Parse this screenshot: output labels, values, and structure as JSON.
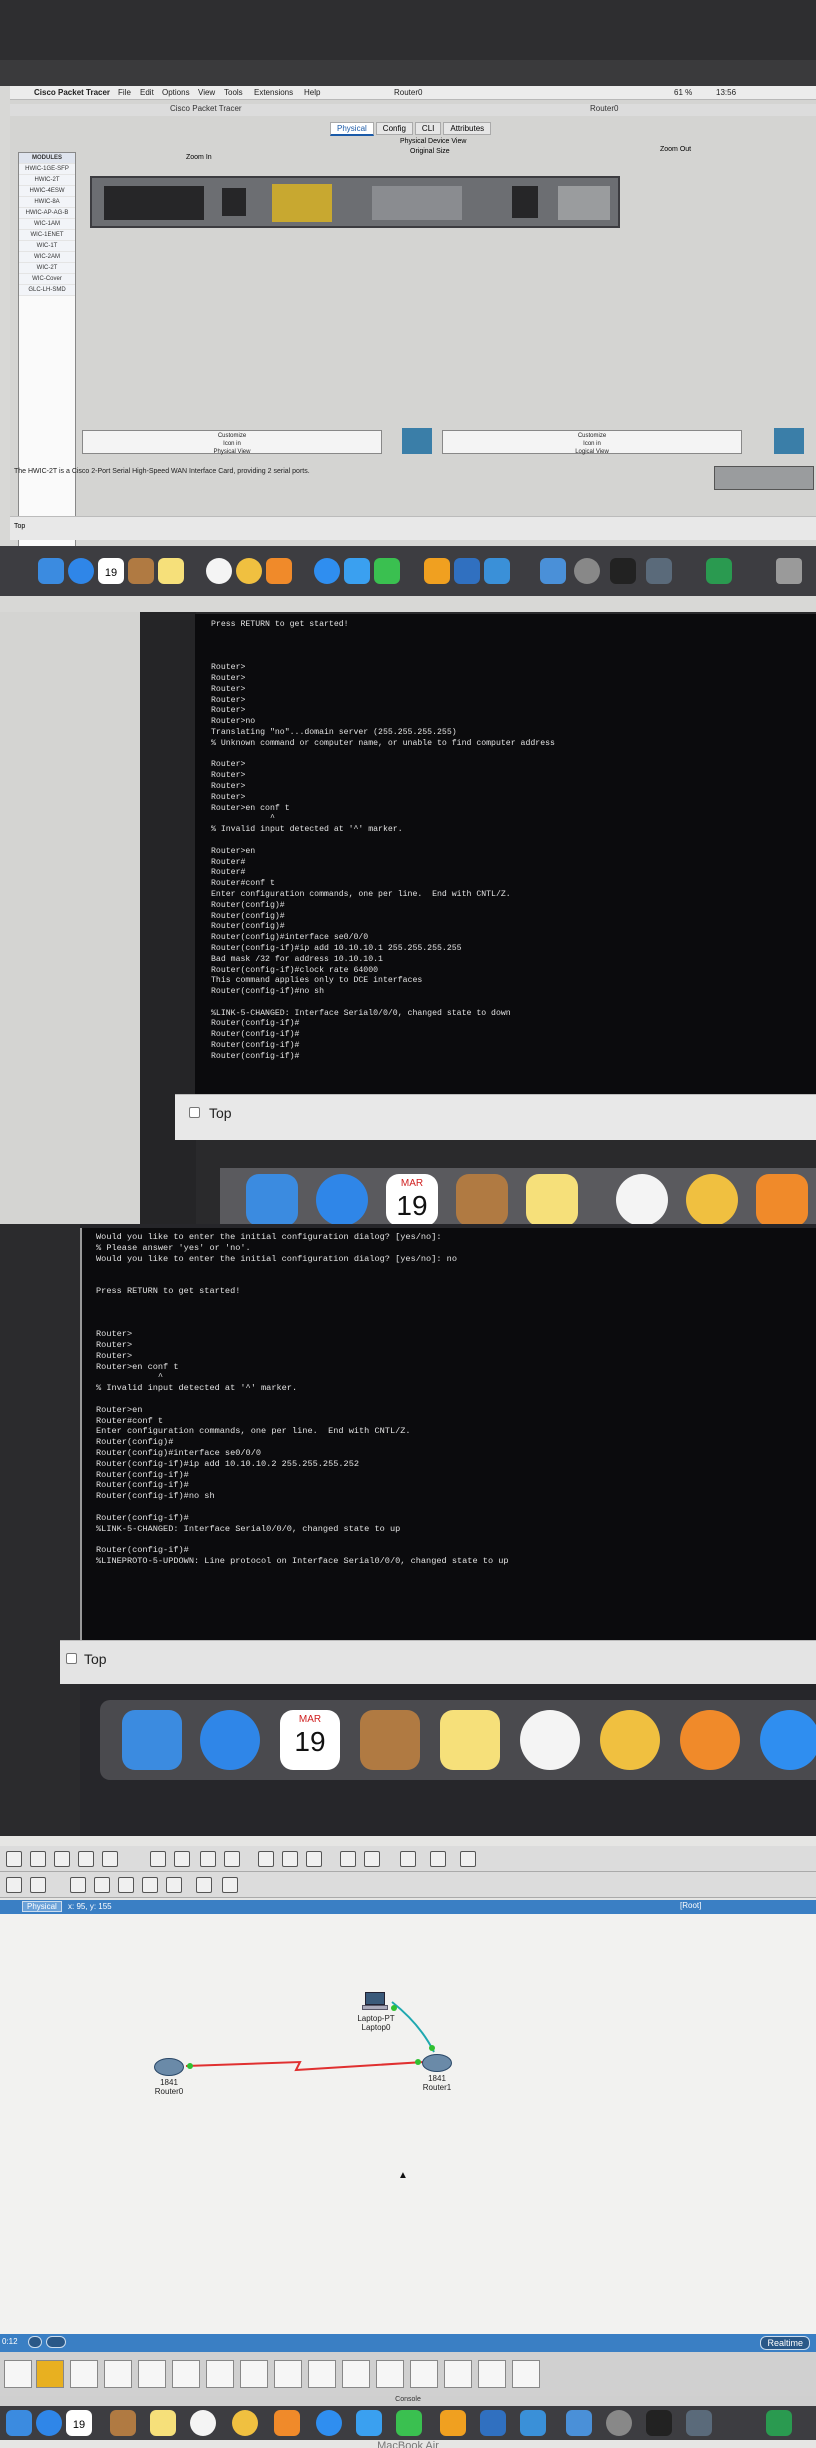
{
  "photo1": {
    "menubar": {
      "app_name": "Cisco Packet Tracer",
      "menus": [
        "File",
        "Edit",
        "Options",
        "View",
        "Tools",
        "Extensions",
        "Help"
      ],
      "window_title": "Router0",
      "right_title": "Router0",
      "battery": "61 %",
      "clock": "13:56"
    },
    "subtitle": "Cisco Packet Tracer",
    "tabs": [
      "Physical",
      "Config",
      "CLI",
      "Attributes"
    ],
    "view_title": "Physical Device View",
    "zoom_in": "Zoom In",
    "original_size": "Original Size",
    "zoom_out": "Zoom Out",
    "modules_header": "MODULES",
    "modules": [
      "HWIC-1GE-SFP",
      "HWIC-2T",
      "HWIC-4ESW",
      "HWIC-8A",
      "HWIC-AP-AG-B",
      "WIC-1AM",
      "WIC-1ENET",
      "WIC-1T",
      "WIC-2AM",
      "WIC-2T",
      "WIC-Cover",
      "GLC-LH-SMD"
    ],
    "customize_physical": [
      "Customize",
      "Icon in",
      "Physical View"
    ],
    "customize_logical": [
      "Customize",
      "Icon in",
      "Logical View"
    ],
    "status_text": "The HWIC-2T is a Cisco 2-Port Serial High-Speed WAN Interface Card, providing 2 serial ports.",
    "top_label": "Top",
    "calendar_day": "19"
  },
  "photo2": {
    "terminal_lines": [
      "Press RETURN to get started!",
      "",
      "",
      "",
      "Router>",
      "Router>",
      "Router>",
      "Router>",
      "Router>",
      "Router>no",
      "Translating \"no\"...domain server (255.255.255.255)",
      "% Unknown command or computer name, or unable to find computer address",
      "",
      "Router>",
      "Router>",
      "Router>",
      "Router>",
      "Router>en conf t",
      "            ^",
      "% Invalid input detected at '^' marker.",
      "",
      "Router>en",
      "Router#",
      "Router#",
      "Router#conf t",
      "Enter configuration commands, one per line.  End with CNTL/Z.",
      "Router(config)#",
      "Router(config)#",
      "Router(config)#",
      "Router(config)#interface se0/0/0",
      "Router(config-if)#ip add 10.10.10.1 255.255.255.255",
      "Bad mask /32 for address 10.10.10.1",
      "Router(config-if)#clock rate 64000",
      "This command applies only to DCE interfaces",
      "Router(config-if)#no sh",
      "",
      "%LINK-5-CHANGED: Interface Serial0/0/0, changed state to down",
      "Router(config-if)#",
      "Router(config-if)#",
      "Router(config-if)#",
      "Router(config-if)#"
    ],
    "top_label": "Top",
    "calendar_month": "MAR",
    "calendar_day": "19"
  },
  "photo3": {
    "terminal_lines": [
      "Would you like to enter the initial configuration dialog? [yes/no]:",
      "% Please answer 'yes' or 'no'.",
      "Would you like to enter the initial configuration dialog? [yes/no]: no",
      "",
      "",
      "Press RETURN to get started!",
      "",
      "",
      "",
      "Router>",
      "Router>",
      "Router>",
      "Router>en conf t",
      "            ^",
      "% Invalid input detected at '^' marker.",
      "",
      "Router>en",
      "Router#conf t",
      "Enter configuration commands, one per line.  End with CNTL/Z.",
      "Router(config)#",
      "Router(config)#interface se0/0/0",
      "Router(config-if)#ip add 10.10.10.2 255.255.255.252",
      "Router(config-if)#",
      "Router(config-if)#",
      "Router(config-if)#no sh",
      "",
      "Router(config-if)#",
      "%LINK-5-CHANGED: Interface Serial0/0/0, changed state to up",
      "",
      "Router(config-if)#",
      "%LINEPROTO-5-UPDOWN: Line protocol on Interface Serial0/0/0, changed state to up"
    ],
    "top_label": "Top",
    "calendar_month": "MAR",
    "calendar_day": "19"
  },
  "photo4": {
    "physical_tab": "Physical",
    "coords": "x: 95, y: 155",
    "root_label": "[Root]",
    "laptop_label": [
      "Laptop-PT",
      "Laptop0"
    ],
    "router0_label": [
      "1841",
      "Router0"
    ],
    "router1_label": [
      "1841",
      "Router1"
    ],
    "time_readout": "0:12",
    "realtime": "Realtime",
    "console_label": "Console",
    "brand": "MacBook Air",
    "calendar_day": "19",
    "link_color": "#e03030",
    "laptop_link_color": "#20a8b0"
  }
}
